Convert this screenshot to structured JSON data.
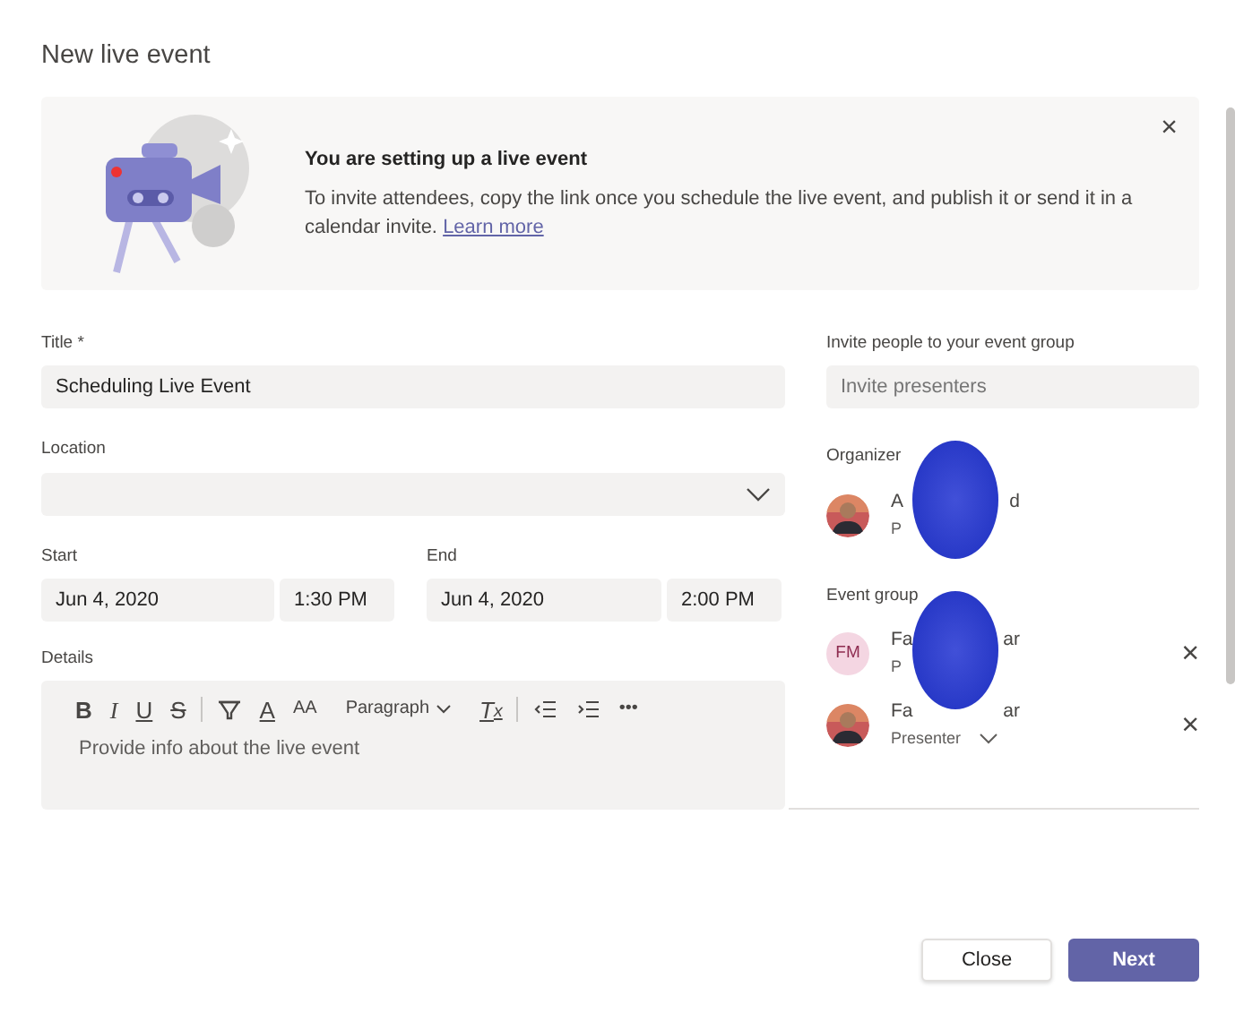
{
  "dialog": {
    "title": "New live event"
  },
  "banner": {
    "heading": "You are setting up a live event",
    "text": "To invite attendees, copy the link once you schedule the live event, and publish it or send it in a calendar invite.",
    "link": "Learn more",
    "close": "×"
  },
  "form": {
    "title_label": "Title *",
    "title_value": "Scheduling Live Event",
    "location_label": "Location",
    "start_label": "Start",
    "start_date": "Jun 4, 2020",
    "start_time": "1:30 PM",
    "end_label": "End",
    "end_date": "Jun 4, 2020",
    "end_time": "2:00 PM",
    "details_label": "Details",
    "details_placeholder": "Provide info about the live event",
    "toolbar": [
      {
        "kind": "bold",
        "label": "B"
      },
      {
        "kind": "italic",
        "label": "I"
      },
      {
        "kind": "underline",
        "label": "U"
      },
      {
        "kind": "strike",
        "label": "S"
      },
      {
        "kind": "separator"
      },
      {
        "kind": "highlight"
      },
      {
        "kind": "fontcolor",
        "label": "A"
      },
      {
        "kind": "fontsize",
        "label": "AA"
      },
      {
        "kind": "dropdown",
        "label": "Paragraph"
      },
      {
        "kind": "clear",
        "label": "T$_{x}$"
      },
      {
        "kind": "separator"
      },
      {
        "kind": "outdent"
      },
      {
        "kind": "indent"
      },
      {
        "kind": "more",
        "label": "•••"
      }
    ]
  },
  "people": {
    "invite_label": "Invite people to your event group",
    "invite_placeholder": "Invite presenters",
    "organizer_label": "Organizer",
    "organizer": {
      "kind": "picture",
      "name_start": "A",
      "name_end": "d",
      "role": "P"
    },
    "group_label": "Event group",
    "group": [
      {
        "kind": "initials",
        "initials": "FM",
        "name_start": "Fa",
        "name_end": "ar",
        "role": "P",
        "remove": "×"
      },
      {
        "kind": "picture",
        "name_start": "Fa",
        "name_end": "ar",
        "role": "Presenter",
        "role_menu": true,
        "remove": "×"
      }
    ]
  },
  "buttons": [
    {
      "label": "Close",
      "primary": false
    },
    {
      "label": "Next",
      "primary": true
    }
  ]
}
